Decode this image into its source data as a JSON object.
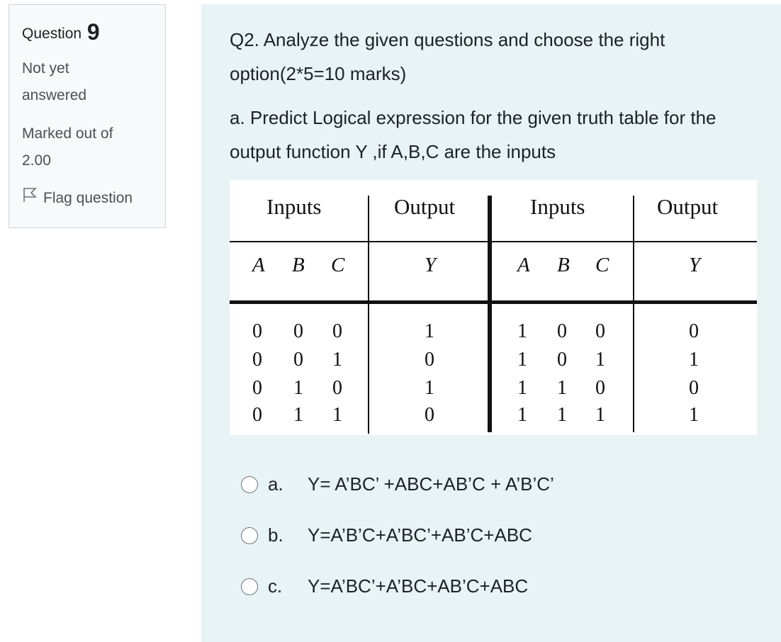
{
  "info": {
    "question_label": "Question",
    "question_number": "9",
    "state": "Not yet answered",
    "grade": "Marked out of 2.00",
    "flag_label": "Flag question"
  },
  "question": {
    "intro": "Q2. Analyze the given questions and choose the right option(2*5=10 marks)",
    "sub": "a. Predict Logical expression for the given truth table  for the output function Y ,if A,B,C are the inputs"
  },
  "truth_table": {
    "header_inputs": "Inputs",
    "header_output": "Output",
    "vars": [
      "A",
      "B",
      "C"
    ],
    "out_var": "Y",
    "left_rows": [
      [
        "0",
        "0",
        "0",
        "1"
      ],
      [
        "0",
        "0",
        "1",
        "0"
      ],
      [
        "0",
        "1",
        "0",
        "1"
      ],
      [
        "0",
        "1",
        "1",
        "0"
      ]
    ],
    "right_rows": [
      [
        "1",
        "0",
        "0",
        "0"
      ],
      [
        "1",
        "0",
        "1",
        "1"
      ],
      [
        "1",
        "1",
        "0",
        "0"
      ],
      [
        "1",
        "1",
        "1",
        "1"
      ]
    ]
  },
  "options": [
    {
      "letter": "a.",
      "text": "Y= A’BC’ +ABC+AB’C + A’B’C’"
    },
    {
      "letter": "b.",
      "text": "Y=A’B’C+A’BC’+AB’C+ABC"
    },
    {
      "letter": "c.",
      "text": "Y=A’BC’+A’BC+AB’C+ABC"
    }
  ],
  "colors": {
    "content_bg": "#e7f3f5",
    "info_bg": "#f8f9fa",
    "info_border": "#cfd4d9"
  }
}
